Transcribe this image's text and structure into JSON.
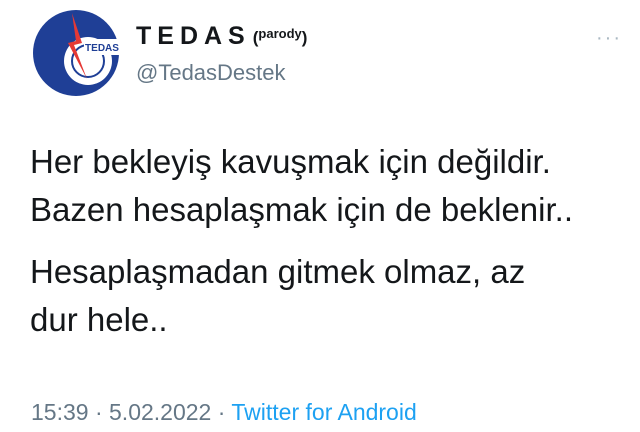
{
  "tweet": {
    "display_name": "TEDAS",
    "parody_open": "(",
    "parody_tag": "parody",
    "parody_close": ")",
    "handle": "@TedasDestek",
    "avatar_text": "TEDAS",
    "more": "···",
    "lines": [
      "Her bekleyiş kavuşmak için değildir.",
      "Bazen hesaplaşmak için de beklenir..",
      "Hesaplaşmadan gitmek olmaz, az",
      "dur hele.."
    ],
    "time": "15:39",
    "separator": "·",
    "date": "5.02.2022",
    "source": "Twitter for Android"
  },
  "colors": {
    "brand_blue": "#1f3f96",
    "brand_red": "#e53935",
    "link_blue": "#1da1f2",
    "meta_gray": "#657786"
  }
}
